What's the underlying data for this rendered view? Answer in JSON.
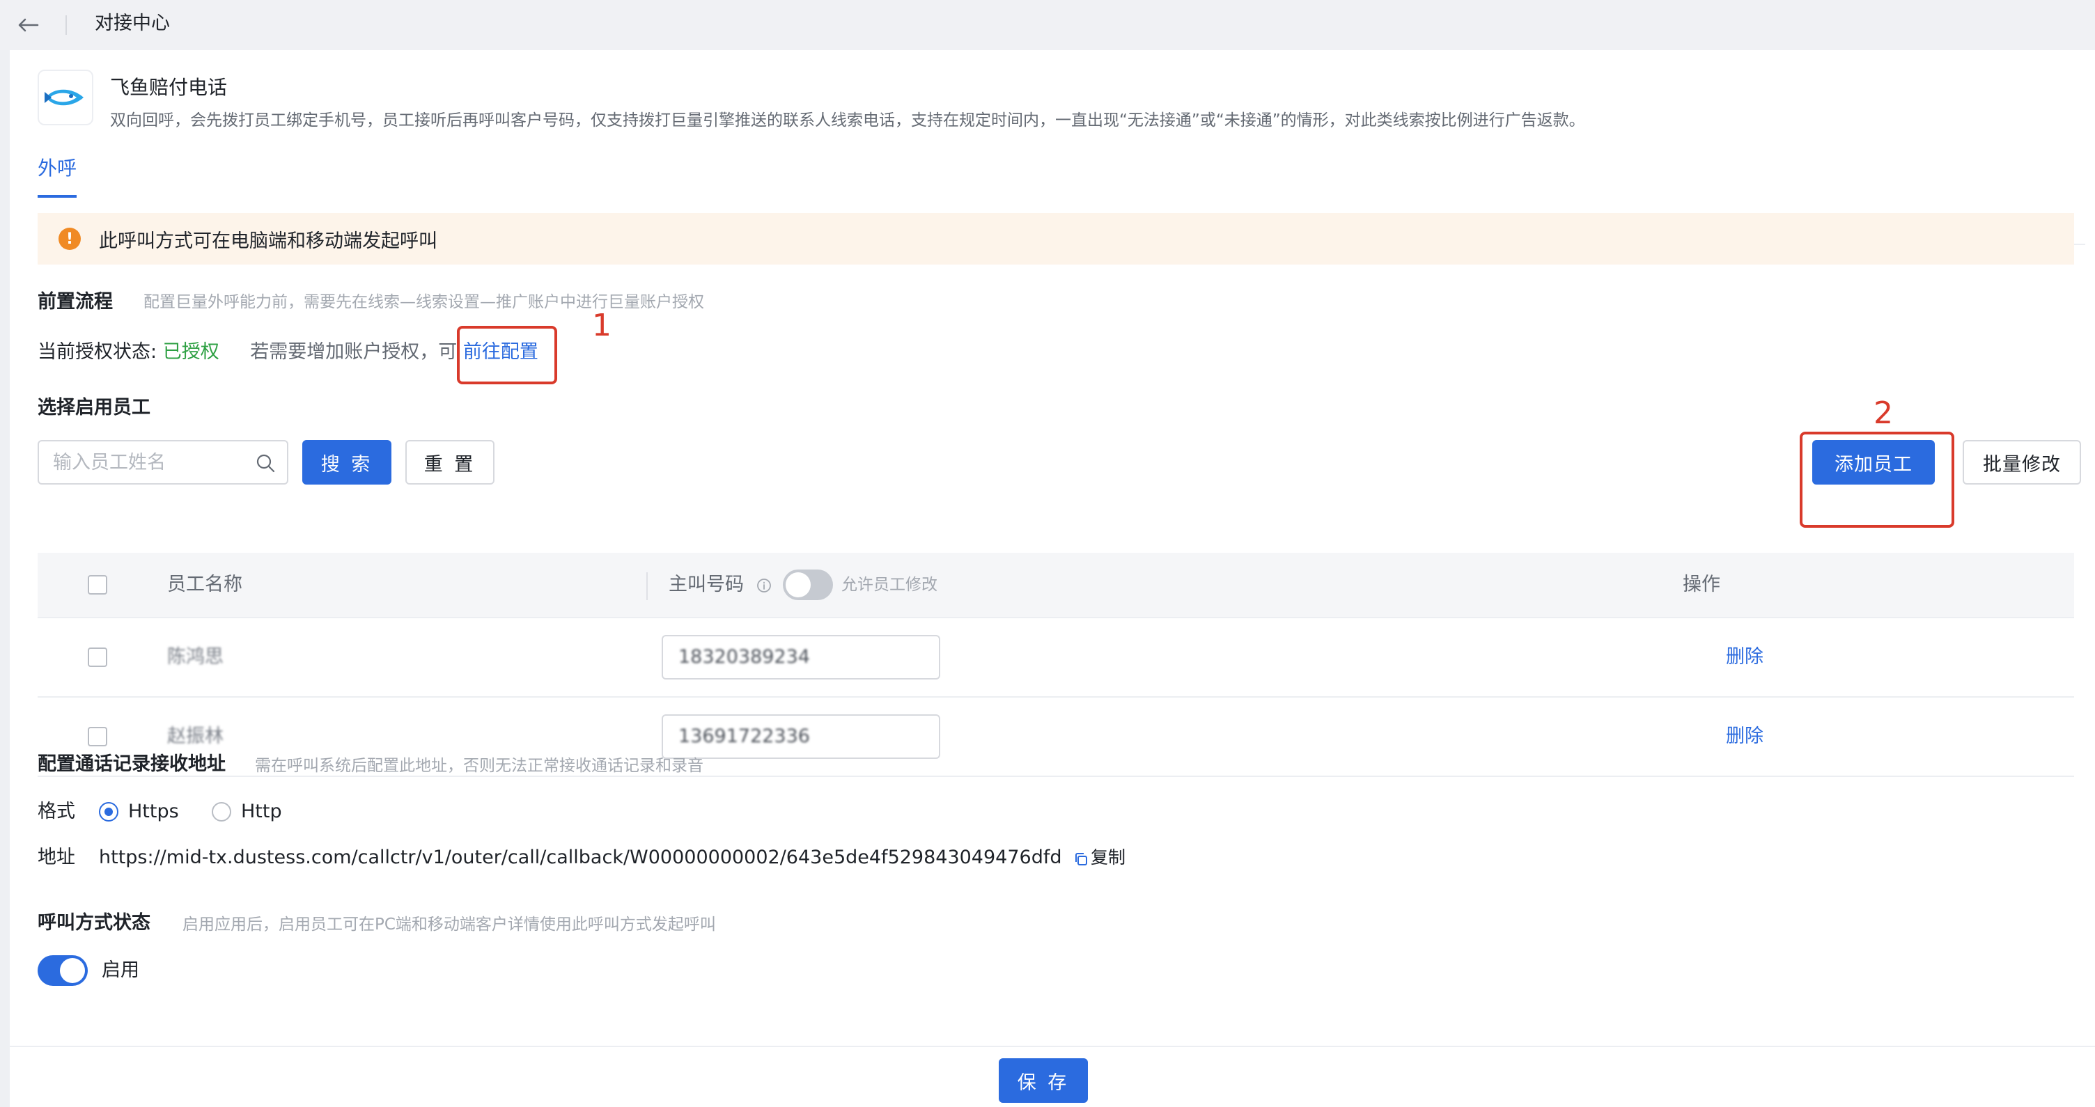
{
  "topbar": {
    "title": "对接中心"
  },
  "app": {
    "name": "飞鱼赔付电话",
    "description": "双向回呼，会先拨打员工绑定手机号，员工接听后再呼叫客户号码，仅支持拨打巨量引擎推送的联系人线索电话，支持在规定时间内，一直出现“无法接通”或“未接通”的情形，对此类线索按比例进行广告返款。"
  },
  "tabs": [
    {
      "label": "外呼",
      "active": true
    }
  ],
  "alert": {
    "text": "此呼叫方式可在电脑端和移动端发起呼叫"
  },
  "pre_process": {
    "title": "前置流程",
    "hint": "配置巨量外呼能力前，需要先在线索—线索设置—推广账户中进行巨量账户授权",
    "status_label": "当前授权状态:",
    "status_value": "已授权",
    "add_hint": "若需要增加账户授权，可",
    "link": "前往配置"
  },
  "staff": {
    "title": "选择启用员工",
    "search_placeholder": "输入员工姓名",
    "search_button": "搜 索",
    "reset_button": "重 置",
    "add_button": "添加员工",
    "batch_button": "批量修改",
    "columns": {
      "name": "员工名称",
      "phone": "主叫号码",
      "toggle_label": "允许员工修改",
      "action": "操作"
    },
    "rows": [
      {
        "name": "陈鸿思",
        "phone": "18320389234",
        "action": "删除"
      },
      {
        "name": "赵振林",
        "phone": "13691722336",
        "action": "删除"
      }
    ]
  },
  "callback": {
    "title": "配置通话记录接收地址",
    "hint": "需在呼叫系统后配置此地址，否则无法正常接收通话记录和录音",
    "format_label": "格式",
    "options": [
      "Https",
      "Http"
    ],
    "selected": "Https",
    "address_label": "地址",
    "address": "https://mid-tx.dustess.com/callctr/v1/outer/call/callback/W00000000002/643e5de4f529843049476dfd",
    "copy_label": "复制"
  },
  "call_status": {
    "title": "呼叫方式状态",
    "hint": "启用应用后，启用员工可在PC端和移动端客户详情使用此呼叫方式发起呼叫",
    "toggle_label": "启用",
    "enabled": true
  },
  "annotations": [
    "1",
    "2"
  ],
  "footer": {
    "save_button": "保 存"
  },
  "colors": {
    "primary": "#2b6bdf",
    "success": "#2ea043",
    "warning": "#f08a24",
    "annotation": "#d93a2b"
  }
}
